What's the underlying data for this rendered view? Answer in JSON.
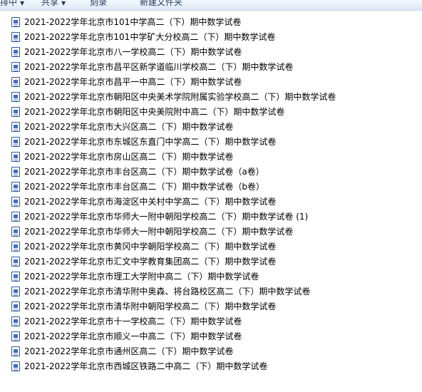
{
  "toolbar": {
    "items": [
      {
        "label": "排中"
      },
      {
        "label": "共享"
      },
      {
        "label": "刻录"
      },
      {
        "label": "新建文件夹"
      }
    ]
  },
  "files": [
    "2021-2022学年北京市101中学高二（下）期中数学试卷",
    "2021-2022学年北京市101中学矿大分校高二（下）期中数学试卷",
    "2021-2022学年北京市八一学校高二（下）期中数学试卷",
    "2021-2022学年北京市昌平区新学道临川学校高二（下）期中数学试卷",
    "2021-2022学年北京市昌平一中高二（下）期中数学试卷",
    "2021-2022学年北京市朝阳区中央美术学院附属实验学校高二（下）期中数学试卷",
    "2021-2022学年北京市朝阳区中央美院附中高二（下）期中数学试卷",
    "2021-2022学年北京市大兴区高二（下）期中数学试卷",
    "2021-2022学年北京市东城区东直门中学高二（下）期中数学试卷",
    "2021-2022学年北京市房山区高二（下）期中数学试卷",
    "2021-2022学年北京市丰台区高二（下）期中数学试卷（a卷）",
    "2021-2022学年北京市丰台区高二（下）期中数学试卷（b卷）",
    "2021-2022学年北京市海淀区中关村中学高二（下）期中数学试卷",
    "2021-2022学年北京市华师大一附中朝阳学校高二（下）期中数学试卷 (1)",
    "2021-2022学年北京市华师大一附中朝阳学校高二（下）期中数学试卷",
    "2021-2022学年北京市黄冈中学朝阳学校高二（下）期中数学试卷",
    "2021-2022学年北京市汇文中学教育集团高二（下）期中数学试卷",
    "2021-2022学年北京市理工大学附中高二（下）期中数学试卷",
    "2021-2022学年北京市清华附中奥森、将台路校区高二（下）期中数学试卷",
    "2021-2022学年北京市清华附中朝阳学校高二（下）期中数学试卷",
    "2021-2022学年北京市十一学校高二（下）期中数学试卷",
    "2021-2022学年北京市顺义一中高二（下）期中数学试卷",
    "2021-2022学年北京市通州区高二（下）期中数学试卷",
    "2021-2022学年北京市西城区铁路二中高二（下）期中数学试卷"
  ]
}
